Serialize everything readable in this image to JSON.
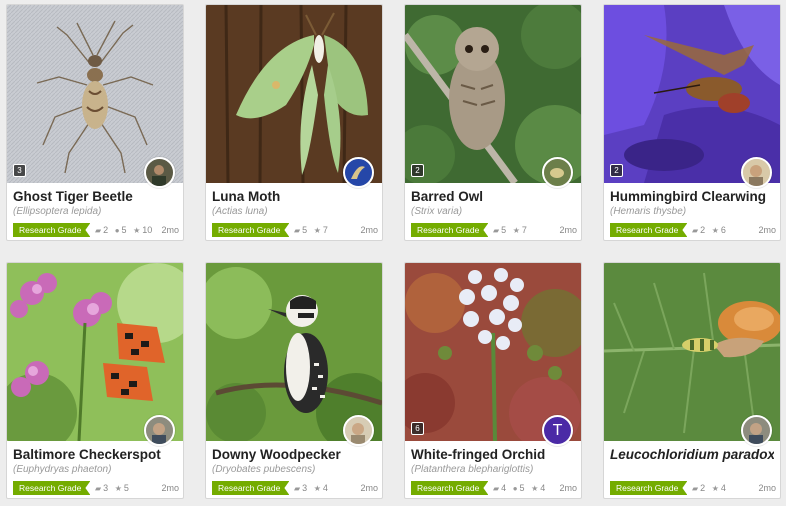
{
  "observations": [
    {
      "common_name": "Ghost Tiger Beetle",
      "scientific_name": "(Ellipsoptera lepida)",
      "grade": "Research Grade",
      "ids": "2",
      "comments": "5",
      "faves": "10",
      "age": "2mo",
      "photo_count": "3"
    },
    {
      "common_name": "Luna Moth",
      "scientific_name": "(Actias luna)",
      "grade": "Research Grade",
      "ids": "5",
      "faves": "7",
      "age": "2mo"
    },
    {
      "common_name": "Barred Owl",
      "scientific_name": "(Strix varia)",
      "grade": "Research Grade",
      "ids": "5",
      "faves": "7",
      "age": "2mo",
      "photo_count": "2"
    },
    {
      "common_name": "Hummingbird Clearwing",
      "scientific_name": "(Hemaris thysbe)",
      "grade": "Research Grade",
      "ids": "2",
      "faves": "6",
      "age": "2mo",
      "photo_count": "2"
    },
    {
      "common_name": "Baltimore Checkerspot",
      "scientific_name": "(Euphydryas phaeton)",
      "grade": "Research Grade",
      "ids": "3",
      "faves": "5",
      "age": "2mo"
    },
    {
      "common_name": "Downy Woodpecker",
      "scientific_name": "(Dryobates pubescens)",
      "grade": "Research Grade",
      "ids": "3",
      "faves": "4",
      "age": "2mo"
    },
    {
      "common_name": "White-fringed Orchid",
      "scientific_name": "(Platanthera blephariglottis)",
      "grade": "Research Grade",
      "ids": "4",
      "comments": "5",
      "faves": "4",
      "age": "2mo",
      "photo_count": "6",
      "avatar_letter": "T"
    },
    {
      "common_name": "Leucochloridium paradoxum",
      "grade": "Research Grade",
      "ids": "2",
      "faves": "4",
      "age": "2mo"
    }
  ],
  "icons": {
    "id": "id-badge-icon",
    "comment": "comment-icon",
    "fave": "star-icon"
  },
  "colors": {
    "research_grade": "#74ac00",
    "avatar_letter_bg": "#4b2aa6"
  }
}
